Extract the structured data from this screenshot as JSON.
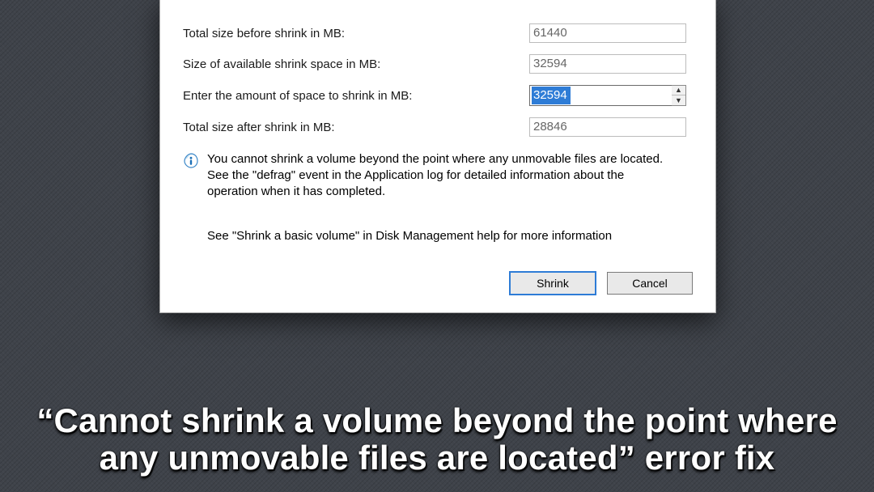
{
  "fields": {
    "before": {
      "label": "Total size before shrink in MB:",
      "value": "61440"
    },
    "available": {
      "label": "Size of available shrink space in MB:",
      "value": "32594"
    },
    "enter": {
      "label": "Enter the amount of space to shrink in MB:",
      "value": "32594"
    },
    "after": {
      "label": "Total size after shrink in MB:",
      "value": "28846"
    }
  },
  "info": {
    "text": "You cannot shrink a volume beyond the point where any unmovable files are located. See the \"defrag\" event in the Application log for detailed information about the operation when it has completed.",
    "help": "See \"Shrink a basic volume\" in Disk Management help for more information"
  },
  "buttons": {
    "shrink": "Shrink",
    "cancel": "Cancel"
  },
  "caption": {
    "line1": "“Cannot shrink a volume beyond the point where",
    "line2": "any unmovable files are located” error fix"
  }
}
